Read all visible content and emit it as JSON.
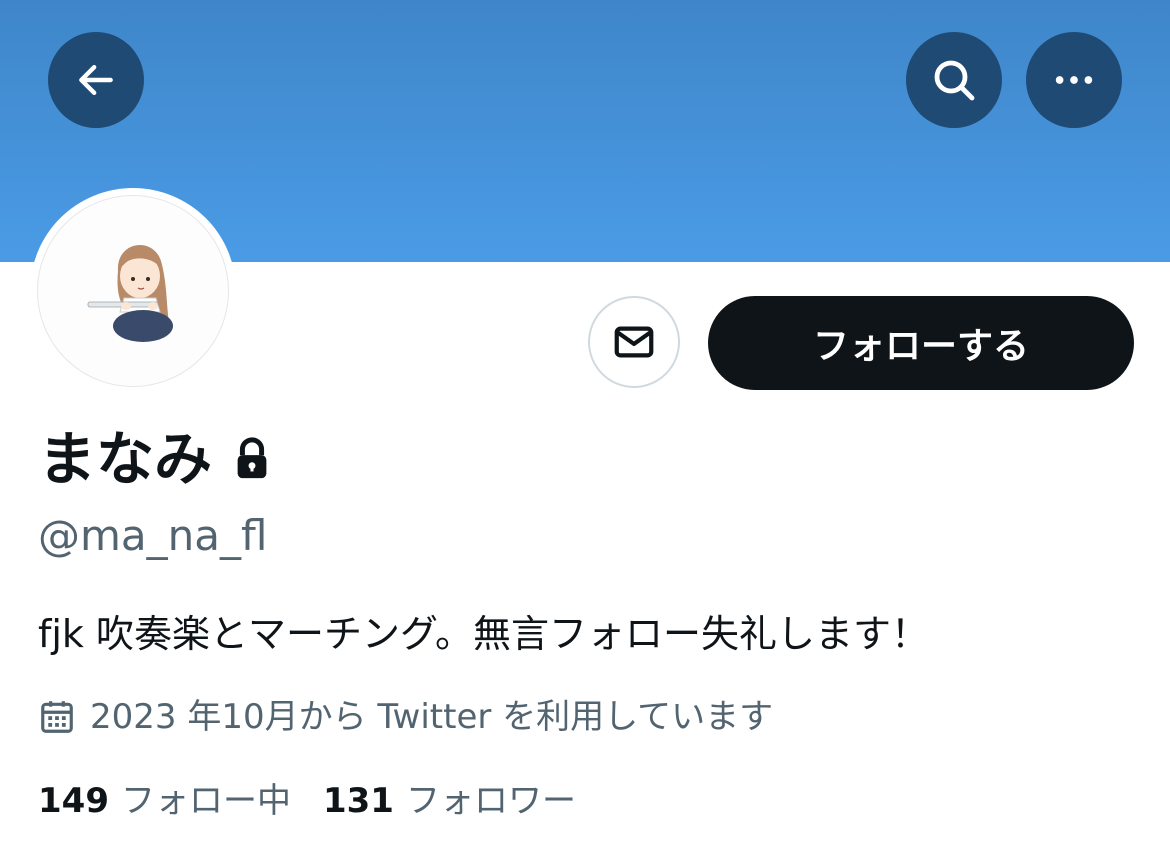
{
  "header": {
    "back_icon": "arrow-left-icon",
    "search_icon": "search-icon",
    "more_icon": "more-horizontal-icon",
    "banner_color": "#4a9be6"
  },
  "profile": {
    "display_name": "まなみ",
    "protected_icon": "lock-icon",
    "handle": "@ma_na_fl",
    "bio": "fjk 吹奏楽とマーチング。無言フォロー失礼します！",
    "joined_icon": "calendar-icon",
    "joined": "2023 年10月から Twitter を利用しています"
  },
  "actions": {
    "message_icon": "envelope-icon",
    "follow_label": "フォローする"
  },
  "stats": {
    "following_count": "149",
    "following_label": "フォロー中",
    "followers_count": "131",
    "followers_label": "フォロワー"
  },
  "colors": {
    "text_primary": "#0f1419",
    "text_secondary": "#536471",
    "follow_button_bg": "#0f1419",
    "header_button_bg": "#1f4a73"
  }
}
